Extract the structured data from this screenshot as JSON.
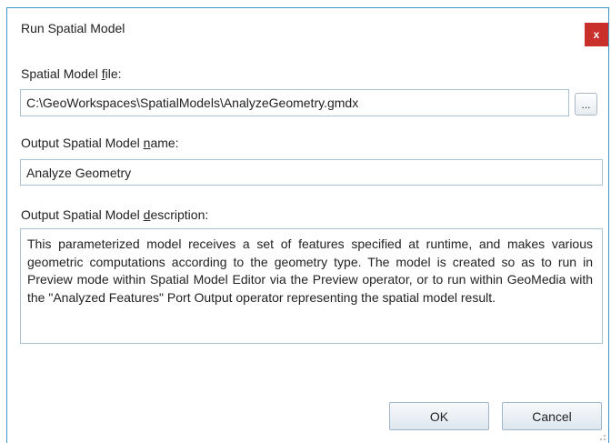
{
  "dialog": {
    "title": "Run Spatial Model",
    "close_glyph": "x",
    "close_icon": "close-icon"
  },
  "model_file": {
    "label_pre": "Spatial Model ",
    "label_key": "f",
    "label_post": "ile:",
    "value": "C:\\GeoWorkspaces\\SpatialModels\\AnalyzeGeometry.gmdx",
    "browse_label": "..."
  },
  "output_name": {
    "label_pre": "Output Spatial Model ",
    "label_key": "n",
    "label_post": "ame:",
    "value": "Analyze Geometry"
  },
  "output_description": {
    "label_pre": "Output Spatial Model ",
    "label_key": "d",
    "label_post": "escription:",
    "value": "This parameterized model receives a set of features specified at runtime, and makes various geometric computations according to the geometry type.  The model is created so as to run in Preview mode within Spatial Model Editor via the Preview operator, or to run within GeoMedia with the \"Analyzed Features\" Port Output operator representing the spatial model result."
  },
  "buttons": {
    "ok_label": "OK",
    "cancel_label": "Cancel"
  },
  "colors": {
    "border_accent": "#3f96c8",
    "close_bg": "#c9302c"
  }
}
